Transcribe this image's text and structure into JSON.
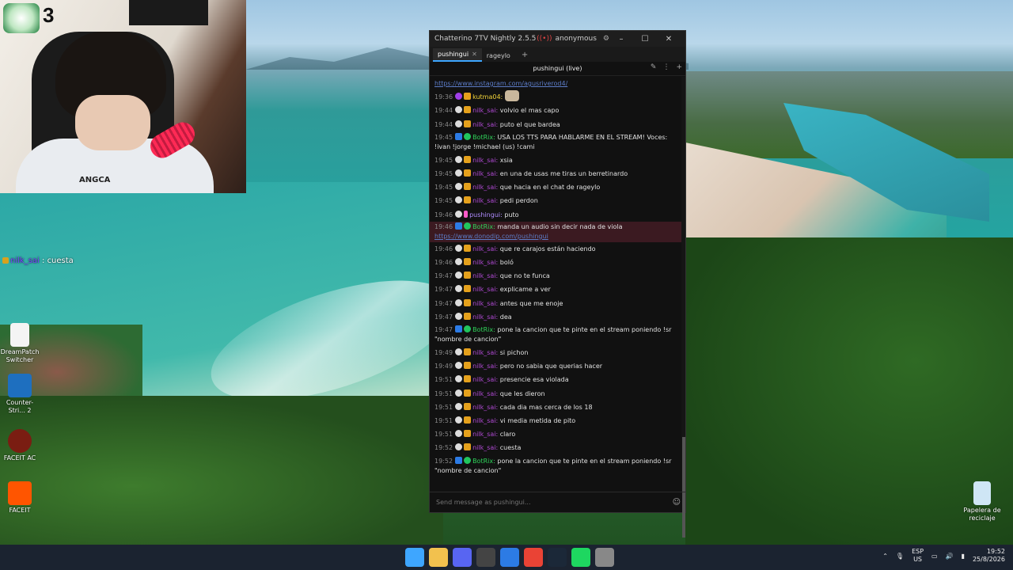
{
  "webcam": {
    "counter": "3",
    "shirt_text": "ANGCA"
  },
  "overlay_message": {
    "user": "nilk_sai",
    "sep": ":",
    "text": "cuesta"
  },
  "desktop_icons": [
    {
      "label": "DreamPatch Switcher"
    },
    {
      "label": "Counter-Stri... 2"
    },
    {
      "label": "FACEIT AC"
    },
    {
      "label": "FACEIT"
    },
    {
      "label": "Papelera de reciclaje"
    }
  ],
  "chat_window": {
    "title": "Chatterino 7TV Nightly 2.5.5",
    "account": "anonymous",
    "tabs": [
      {
        "label": "pushingui",
        "active": true
      },
      {
        "label": "rageylo",
        "active": false
      }
    ],
    "channel_header": "pushingui (live)",
    "colors": {
      "nilk_sai": "#b24ad6",
      "botrix": "#2fd35a",
      "kutma": "#f2d43a",
      "pushingui": "#b08cff"
    },
    "messages": [
      {
        "kind": "link",
        "text": "https://www.instagram.com/agusriverod4/"
      },
      {
        "time": "19:36",
        "user": "kutma04",
        "ucolor": "#f2d43a",
        "text": "",
        "emote": "cat"
      },
      {
        "time": "19:44",
        "user": "nilk_sai",
        "ucolor": "#b24ad6",
        "text": "volvio el mas capo"
      },
      {
        "time": "19:44",
        "user": "nilk_sai",
        "ucolor": "#b24ad6",
        "text": "puto el que bardea"
      },
      {
        "time": "19:45",
        "user": "BotRix",
        "ucolor": "#2fd35a",
        "text": "USA LOS TTS PARA HABLARME EN EL STREAM! Voces: !ivan !jorge !michael (us) !cami",
        "wrap": true
      },
      {
        "time": "19:45",
        "user": "nilk_sai",
        "ucolor": "#b24ad6",
        "text": "xsia"
      },
      {
        "time": "19:45",
        "user": "nilk_sai",
        "ucolor": "#b24ad6",
        "text": "en una de usas me tiras un berretinardo"
      },
      {
        "time": "19:45",
        "user": "nilk_sai",
        "ucolor": "#b24ad6",
        "text": "que hacia en el chat de rageylo"
      },
      {
        "time": "19:45",
        "user": "nilk_sai",
        "ucolor": "#b24ad6",
        "text": "pedi perdon"
      },
      {
        "time": "19:46",
        "user": "pushingui",
        "ucolor": "#b08cff",
        "text": "puto"
      },
      {
        "time": "19:46",
        "user": "BotRix",
        "ucolor": "#2fd35a",
        "text": "manda un audio sin decir nada de viola",
        "link": "https://www.donodip.com/pushingui",
        "highlight": true
      },
      {
        "time": "19:46",
        "user": "nilk_sai",
        "ucolor": "#b24ad6",
        "text": "que re carajos están haciendo"
      },
      {
        "time": "19:46",
        "user": "nilk_sai",
        "ucolor": "#b24ad6",
        "text": "boló"
      },
      {
        "time": "19:47",
        "user": "nilk_sai",
        "ucolor": "#b24ad6",
        "text": "que no te funca"
      },
      {
        "time": "19:47",
        "user": "nilk_sai",
        "ucolor": "#b24ad6",
        "text": "explicame a ver"
      },
      {
        "time": "19:47",
        "user": "nilk_sai",
        "ucolor": "#b24ad6",
        "text": "antes que me enoje"
      },
      {
        "time": "19:47",
        "user": "nilk_sai",
        "ucolor": "#b24ad6",
        "text": "dea"
      },
      {
        "time": "19:47",
        "user": "BotRix",
        "ucolor": "#2fd35a",
        "text": "pone la cancion que te pinte en el stream poniendo !sr \"nombre de cancion\"",
        "wrap": true
      },
      {
        "time": "19:49",
        "user": "nilk_sai",
        "ucolor": "#b24ad6",
        "text": "si pichon"
      },
      {
        "time": "19:49",
        "user": "nilk_sai",
        "ucolor": "#b24ad6",
        "text": "pero no sabia que querias hacer"
      },
      {
        "time": "19:51",
        "user": "nilk_sai",
        "ucolor": "#b24ad6",
        "text": "presencie esa violada"
      },
      {
        "time": "19:51",
        "user": "nilk_sai",
        "ucolor": "#b24ad6",
        "text": "que les dieron"
      },
      {
        "time": "19:51",
        "user": "nilk_sai",
        "ucolor": "#b24ad6",
        "text": "cada dia mas cerca de los 18"
      },
      {
        "time": "19:51",
        "user": "nilk_sai",
        "ucolor": "#b24ad6",
        "text": "vi media metida de pito"
      },
      {
        "time": "19:51",
        "user": "nilk_sai",
        "ucolor": "#b24ad6",
        "text": "claro"
      },
      {
        "time": "19:52",
        "user": "nilk_sai",
        "ucolor": "#b24ad6",
        "text": "cuesta"
      },
      {
        "time": "19:52",
        "user": "BotRix",
        "ucolor": "#2fd35a",
        "text": "pone la cancion que te pinte en el stream poniendo !sr \"nombre de cancion\"",
        "wrap": true
      }
    ],
    "input_placeholder": "Send message as pushingui..."
  },
  "taskbar": {
    "apps": [
      {
        "icon": "windows-start-icon",
        "color": "#3ea6ff"
      },
      {
        "icon": "file-explorer-icon",
        "color": "#f2c14e"
      },
      {
        "icon": "discord-icon",
        "color": "#5865f2"
      },
      {
        "icon": "obs-icon",
        "color": "#444444"
      },
      {
        "icon": "chatterino-icon",
        "color": "#2c7be5"
      },
      {
        "icon": "chrome-icon",
        "color": "#ea4335"
      },
      {
        "icon": "steam-icon",
        "color": "#1b2838"
      },
      {
        "icon": "spotify-icon",
        "color": "#1ed760"
      },
      {
        "icon": "app-icon",
        "color": "#888888"
      }
    ],
    "lang_top": "ESP",
    "lang_bottom": "US",
    "time": "19:52",
    "date": "25/8/2026"
  }
}
